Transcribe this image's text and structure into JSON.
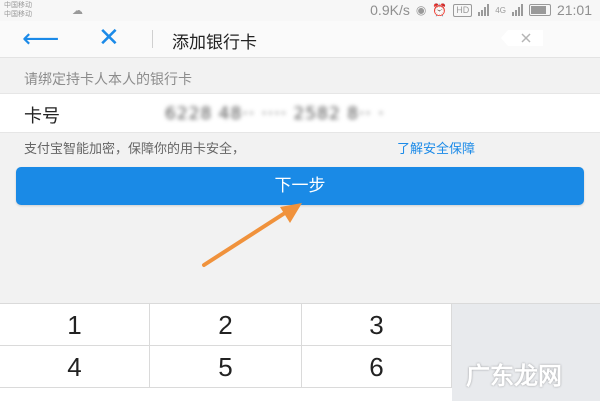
{
  "status_bar": {
    "carrier_1": "中国移动",
    "carrier_2": "中国移动",
    "speed": "0.9K/s",
    "hd": "HD",
    "network": "4G",
    "time": "21:01"
  },
  "nav": {
    "title": "添加银行卡"
  },
  "form": {
    "hint": "请绑定持卡人本人的银行卡",
    "card_label": "卡号",
    "card_value": "6228 48·· ···· 2582 8·· ·",
    "secure_text": "支付宝智能加密，保障你的用卡安全，",
    "secure_link": "了解安全保障",
    "next_button": "下一步"
  },
  "keypad": {
    "keys": [
      "1",
      "2",
      "3",
      "4",
      "5",
      "6"
    ]
  },
  "watermark": "广东龙网",
  "colors": {
    "accent": "#1a8ae6",
    "arrow": "#f0923c"
  }
}
